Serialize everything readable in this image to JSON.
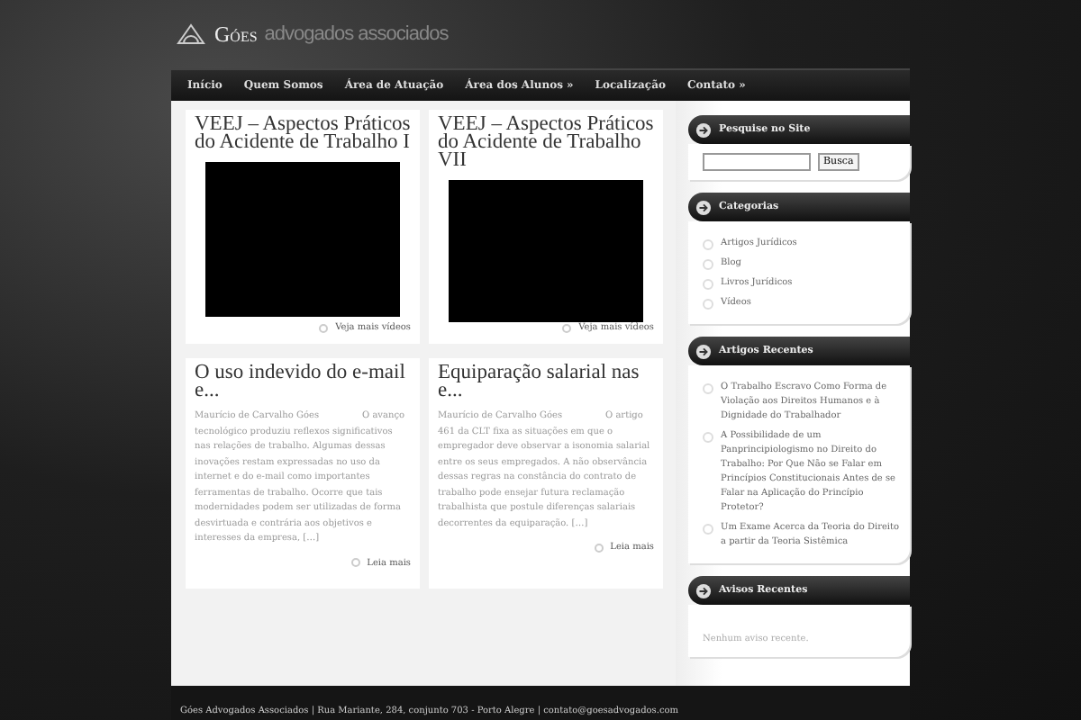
{
  "logo": {
    "name": "Góes",
    "tagline": "advogados associados"
  },
  "nav": [
    {
      "label": "Início"
    },
    {
      "label": "Quem Somos"
    },
    {
      "label": "Área de Atuação"
    },
    {
      "label": "Área dos Alunos »"
    },
    {
      "label": "Localização"
    },
    {
      "label": "Contato »"
    }
  ],
  "posts": [
    {
      "kind": "video",
      "title": "VEEJ – Aspectos Práticos do Acidente de Trabalho I",
      "link": "Veja mais vídeos"
    },
    {
      "kind": "video",
      "title": "VEEJ – Aspectos Práticos do Acidente de Trabalho VII",
      "link": "Veja mais vídeos"
    },
    {
      "kind": "article",
      "title": "O uso indevido do e-mail e...",
      "author": "Maurício de Carvalho Góes",
      "excerpt": "O avanço tecnológico produziu reflexos significativos nas relações de trabalho. Algumas dessas inovações restam expressadas no uso da internet e do e-mail como importantes ferramentas de trabalho. Ocorre que tais modernidades podem ser utilizadas de forma desvirtuada e contrária aos objetivos e interesses da empresa, […]",
      "link": "Leia mais"
    },
    {
      "kind": "article",
      "title": "Equiparação salarial nas e...",
      "author": "Maurício de Carvalho Góes",
      "excerpt": "O artigo 461 da CLT fixa as situações em que o empregador deve observar a isonomia salarial entre os seus empregados. A não observância dessas regras na constância do contrato de trabalho pode ensejar futura reclamação trabalhista que postule diferenças salariais decorrentes da equiparação. […]",
      "link": "Leia mais"
    }
  ],
  "sidebar": [
    {
      "kind": "search",
      "title": "Pesquise no Site",
      "button": "Busca"
    },
    {
      "kind": "list",
      "title": "Categorias",
      "items": [
        "Artigos Jurídicos",
        "Blog",
        "Livros Jurídicos",
        "Vídeos"
      ]
    },
    {
      "kind": "list",
      "title": "Artigos Recentes",
      "items": [
        "O Trabalho Escravo Como Forma de Violação aos Direitos Humanos e à Dignidade do Trabalhador",
        "A Possibilidade de um Panprincipiologismo no Direito do Trabalho: Por Que Não se Falar em Princípios Constitucionais Antes de se Falar na Aplicação do Princípio Protetor?",
        "Um Exame Acerca da Teoria do Direito a partir da Teoria Sistêmica"
      ]
    },
    {
      "kind": "text",
      "title": "Avisos Recentes",
      "text": "Nenhum aviso recente."
    }
  ],
  "footer": "Góes Advogados Associados | Rua Mariante, 284, conjunto 703 - Porto Alegre | contato@goesadvogados.com"
}
